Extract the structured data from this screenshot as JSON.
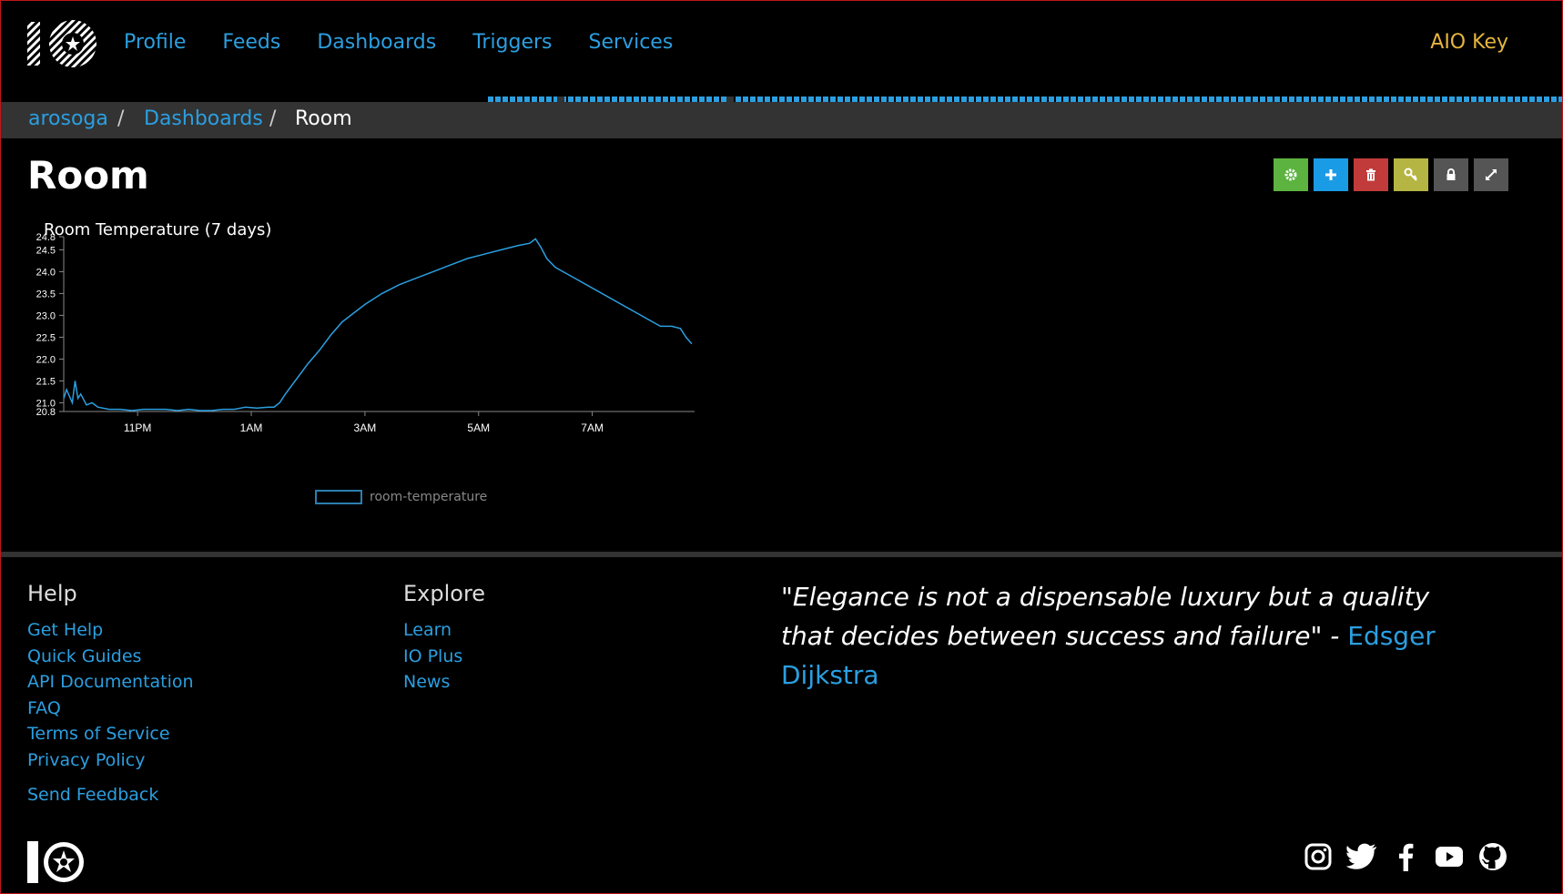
{
  "nav": {
    "items": [
      {
        "label": "Profile"
      },
      {
        "label": "Feeds"
      },
      {
        "label": "Dashboards"
      },
      {
        "label": "Triggers"
      },
      {
        "label": "Services"
      }
    ],
    "aio_key": "AIO Key"
  },
  "breadcrumb": {
    "user": "arosoga",
    "sep": "/",
    "section": "Dashboards",
    "current": "Room"
  },
  "page": {
    "title": "Room"
  },
  "toolbar": {
    "colors": {
      "settings": "#5cb340",
      "add": "#1a9be6",
      "delete": "#c23b3b",
      "key": "#b5b543",
      "lock": "#555555",
      "fullscreen": "#555555"
    },
    "icons": [
      "gear-icon",
      "plus-icon",
      "trash-icon",
      "key-icon",
      "lock-icon",
      "expand-icon"
    ]
  },
  "chart_data": {
    "type": "line",
    "title": "Room Temperature (7 days)",
    "xlabel": "",
    "ylabel": "",
    "x_ticks": [
      "11PM",
      "1AM",
      "3AM",
      "5AM",
      "7AM"
    ],
    "y_ticks": [
      20.8,
      21.0,
      21.5,
      22.0,
      22.5,
      23.0,
      23.5,
      24.0,
      24.5,
      24.8
    ],
    "ylim": [
      20.8,
      24.8
    ],
    "xlim_hours": [
      21.7,
      32.8
    ],
    "grid": false,
    "legend": "bottom",
    "series": [
      {
        "name": "room-temperature",
        "color": "#2b9fe0",
        "x": [
          21.7,
          21.75,
          21.85,
          21.9,
          21.95,
          22.0,
          22.1,
          22.2,
          22.3,
          22.5,
          22.7,
          22.9,
          23.1,
          23.3,
          23.5,
          23.7,
          23.9,
          24.1,
          24.3,
          24.5,
          24.7,
          24.9,
          25.1,
          25.3,
          25.4,
          25.5,
          25.6,
          25.8,
          26.0,
          26.2,
          26.4,
          26.6,
          26.8,
          27.0,
          27.3,
          27.6,
          27.9,
          28.2,
          28.5,
          28.8,
          29.1,
          29.4,
          29.7,
          29.9,
          30.0,
          30.1,
          30.2,
          30.35,
          32.2,
          32.4,
          32.55,
          32.65,
          32.75
        ],
        "values": [
          21.1,
          21.3,
          21.0,
          21.5,
          21.1,
          21.2,
          20.95,
          21.0,
          20.9,
          20.85,
          20.85,
          20.82,
          20.85,
          20.85,
          20.85,
          20.82,
          20.85,
          20.82,
          20.82,
          20.85,
          20.85,
          20.9,
          20.88,
          20.9,
          20.9,
          21.0,
          21.2,
          21.55,
          21.9,
          22.2,
          22.55,
          22.85,
          23.05,
          23.25,
          23.5,
          23.7,
          23.85,
          24.0,
          24.15,
          24.3,
          24.4,
          24.5,
          24.6,
          24.65,
          24.75,
          24.55,
          24.3,
          24.1,
          22.75,
          22.75,
          22.7,
          22.5,
          22.35
        ]
      }
    ]
  },
  "footer": {
    "help_heading": "Help",
    "help_links": [
      "Get Help",
      "Quick Guides",
      "API Documentation",
      "FAQ",
      "Terms of Service",
      "Privacy Policy"
    ],
    "feedback": "Send Feedback",
    "explore_heading": "Explore",
    "explore_links": [
      "Learn",
      "IO Plus",
      "News"
    ],
    "quote_text": "\"Elegance is not a dispensable luxury but a quality that decides between success and failure\" - ",
    "quote_author": "Edsger Dijkstra",
    "social_icons": [
      "instagram-icon",
      "twitter-icon",
      "facebook-icon",
      "youtube-icon",
      "github-icon"
    ]
  }
}
